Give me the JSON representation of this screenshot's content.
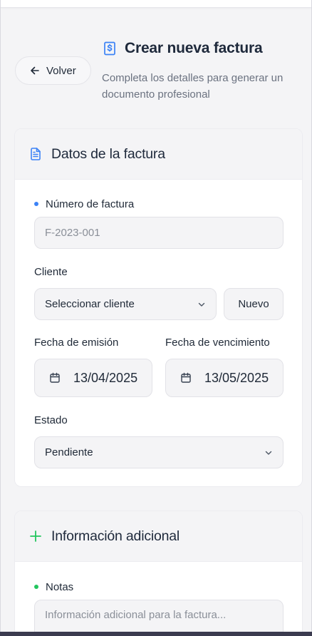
{
  "header": {
    "back_label": "Volver",
    "title": "Crear nueva factura",
    "subtitle": "Completa los detalles para generar un documento profesional"
  },
  "invoice_card": {
    "title": "Datos de la factura",
    "invoice_number": {
      "label": "Número de factura",
      "placeholder": "F-2023-001"
    },
    "client": {
      "label": "Cliente",
      "value": "Seleccionar cliente",
      "new_button": "Nuevo"
    },
    "issue_date": {
      "label": "Fecha de emisión",
      "value": "13/04/2025"
    },
    "due_date": {
      "label": "Fecha de vencimiento",
      "value": "13/05/2025"
    },
    "status": {
      "label": "Estado",
      "value": "Pendiente"
    }
  },
  "additional_card": {
    "title": "Información adicional",
    "notes": {
      "label": "Notas",
      "placeholder": "Información adicional para la factura..."
    }
  },
  "colors": {
    "accent_blue": "#3b82f6",
    "accent_green": "#22c55e",
    "background": "#f4f4f6"
  },
  "icons": [
    "arrow-left-icon",
    "invoice-dollar-icon",
    "document-icon",
    "calendar-icon",
    "chevron-down-icon",
    "plus-icon"
  ]
}
